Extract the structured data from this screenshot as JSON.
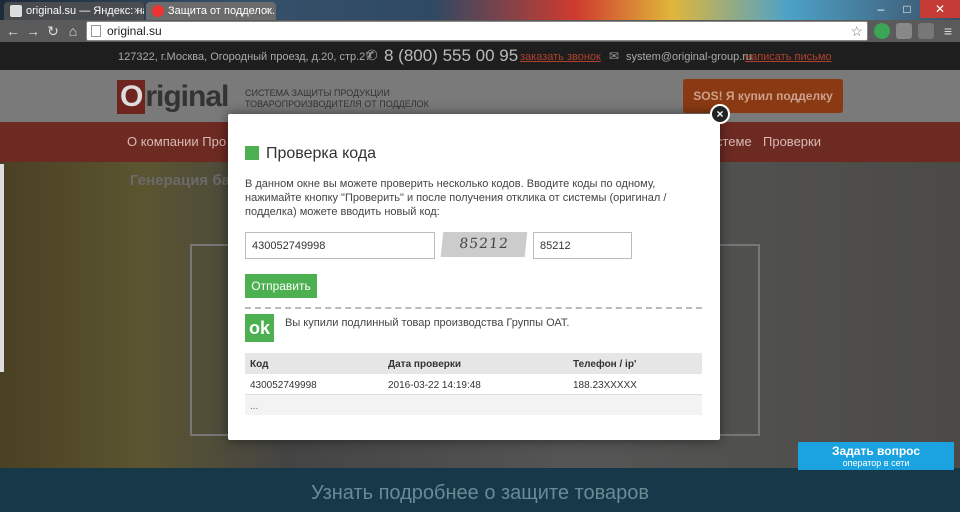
{
  "browser": {
    "tabs": [
      {
        "label": "original.su — Яндекс: на"
      },
      {
        "label": "Защита от подделок. О"
      }
    ],
    "url": "original.su"
  },
  "site": {
    "address": "127322, г.Москва, Огородный проезд, д.20, стр.27",
    "phone": "8 (800) 555 00 95",
    "order_call": "заказать звонок",
    "email": "system@original-group.ru",
    "write_letter": "написать письмо",
    "logo": "Original",
    "tagline_1": "СИСТЕМА ЗАЩИТЫ ПРОДУКЦИИ",
    "tagline_2": "ТОВАРОПРОИЗВОДИТЕЛЯ ОТ ПОДДЕЛОК",
    "sos_button": "SOS! Я купил подделку",
    "menu": {
      "about": "О компании  Про",
      "system": "стеме",
      "checks": "Проверки"
    },
    "hero_heading": "Генерация ба                                                                                    ка кода и уникальных ко                                                                                   сти товара",
    "bottom_banner": "Узнать подробнее о защите товаров",
    "chat": {
      "title": "Задать вопрос",
      "subtitle": "оператор в сети"
    }
  },
  "modal": {
    "title": "Проверка кода",
    "description": "В данном окне вы можете проверить несколько кодов. Вводите коды по одному, нажимайте кнопку \"Проверить\" и после получения отклика от системы (оригинал / подделка) можете вводить новый код:",
    "code_value": "430052749998",
    "captcha_text": "85212",
    "captcha_value": "85212",
    "submit_label": "Отправить",
    "result_badge": "ok",
    "result_text": "Вы купили подлинный товар производства Группы ОАТ.",
    "table": {
      "headers": [
        "Код",
        "Дата проверки",
        "Телефон / ip'"
      ],
      "rows": [
        [
          "430052749998",
          "2016-03-22 14:19:48",
          "188.23XXXXX"
        ]
      ],
      "more": "..."
    }
  },
  "colors": {
    "accent_green": "#4caf50",
    "chat_blue": "#1aa3e0"
  }
}
